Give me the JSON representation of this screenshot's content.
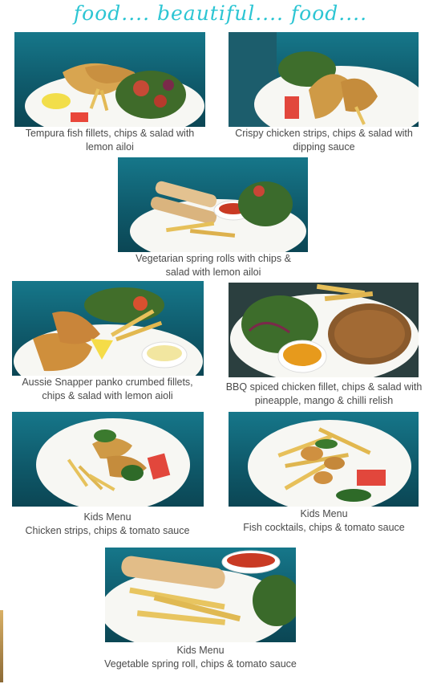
{
  "page_title": "food.... beautiful.... food....",
  "dishes": [
    {
      "line1": "Tempura fish fillets, chips & salad with",
      "line2": "lemon ailoi",
      "image": "tempura-fish-photo"
    },
    {
      "line1": "Crispy chicken strips, chips & salad with",
      "line2": "dipping sauce",
      "image": "chicken-strips-photo"
    },
    {
      "line1": "Vegetarian spring rolls with chips &",
      "line2": "salad with lemon ailoi",
      "image": "spring-rolls-photo"
    },
    {
      "line1": "Aussie Snapper panko crumbed fillets,",
      "line2": "chips & salad with lemon aioli",
      "image": "snapper-photo"
    },
    {
      "line1": "BBQ spiced chicken fillet, chips & salad with",
      "line2": "pineapple, mango & chilli relish",
      "image": "bbq-chicken-photo"
    },
    {
      "line1": "Kids Menu",
      "line2": "Chicken strips, chips & tomato sauce",
      "image": "kids-chicken-photo"
    },
    {
      "line1": "Kids Menu",
      "line2": "Fish cocktails, chips & tomato sauce",
      "image": "kids-fish-photo"
    },
    {
      "line1": "Kids Menu",
      "line2": "Vegetable spring roll, chips & tomato sauce",
      "image": "kids-spring-roll-photo"
    }
  ],
  "colors": {
    "title": "#2cc5d3",
    "caption": "#4a4a4a",
    "water": "#127086",
    "plate": "#f6f6f2"
  }
}
